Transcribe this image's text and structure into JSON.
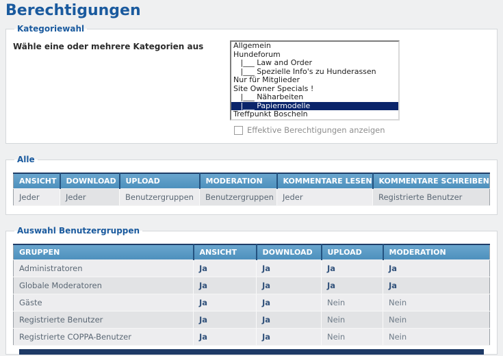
{
  "page": {
    "title": "Berechtigungen"
  },
  "colors": {
    "page_background": "#eff0f1",
    "title_blue": "#1a5a9e",
    "table_header_blue": "#5b9cc9",
    "selection_navy": "#0a246a",
    "ja_navy": "#32527b",
    "row_light": "#ededef",
    "row_dark": "#e2e3e5"
  },
  "category_section": {
    "legend": "Kategoriewahl",
    "label": "Wähle eine oder mehrere Kategorien aus",
    "options": [
      {
        "label": "Allgemein"
      },
      {
        "label": "Hundeforum"
      },
      {
        "label": "   |___ Law and Order"
      },
      {
        "label": "   |___ Spezielle Info's zu Hunderassen"
      },
      {
        "label": "Nur für Mitglieder"
      },
      {
        "label": "Site Owner Specials !"
      },
      {
        "label": "   |___ Näharbeiten"
      },
      {
        "label": "   |___ Papiermodelle",
        "selected": true
      },
      {
        "label": "Treffpunkt Boscheln"
      }
    ],
    "checkbox_label": "Effektive Berechtigungen anzeigen",
    "checkbox_checked": false
  },
  "all_section": {
    "legend": "Alle",
    "columns": [
      "ANSICHT",
      "DOWNLOAD",
      "UPLOAD",
      "MODERATION",
      "KOMMENTARE LESEN",
      "KOMMENTARE SCHREIBEN"
    ],
    "row": [
      "Jeder",
      "Jeder",
      "Benutzergruppen",
      "Benutzergruppen",
      "Jeder",
      "Registrierte Benutzer"
    ]
  },
  "groups_section": {
    "legend": "Auswahl Benutzergruppen",
    "columns": [
      "GRUPPEN",
      "ANSICHT",
      "DOWNLOAD",
      "UPLOAD",
      "MODERATION"
    ],
    "rows": [
      {
        "group": "Administratoren",
        "values": [
          "Ja",
          "Ja",
          "Ja",
          "Ja"
        ]
      },
      {
        "group": "Globale Moderatoren",
        "values": [
          "Ja",
          "Ja",
          "Ja",
          "Ja"
        ]
      },
      {
        "group": "Gäste",
        "values": [
          "Ja",
          "Ja",
          "Nein",
          "Nein"
        ]
      },
      {
        "group": "Registrierte Benutzer",
        "values": [
          "Ja",
          "Ja",
          "Nein",
          "Nein"
        ]
      },
      {
        "group": "Registrierte COPPA-Benutzer",
        "values": [
          "Ja",
          "Ja",
          "Nein",
          "Nein"
        ]
      }
    ]
  }
}
